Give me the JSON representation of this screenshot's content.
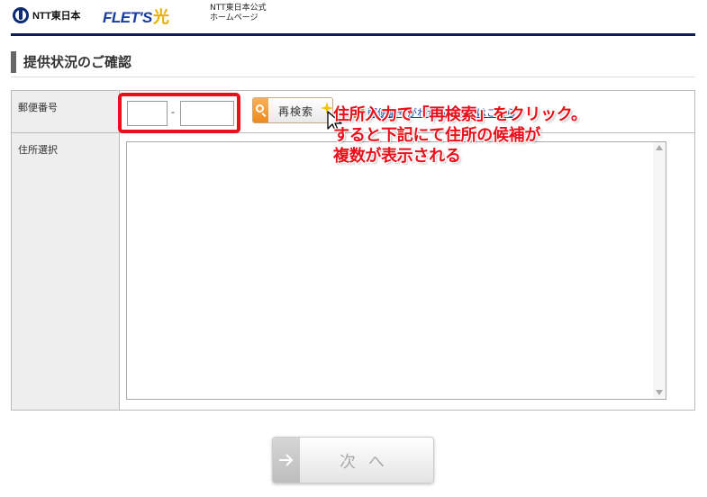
{
  "header": {
    "ntt_logo_text": "NTT東日本",
    "flets_logo_text": "FLET'S",
    "flets_light_text": "光",
    "official_line1": "NTT東日本公式",
    "official_line2": "ホームページ"
  },
  "page": {
    "title": "提供状況のご確認"
  },
  "form": {
    "postal_label": "郵便番号",
    "postal_first_value": "",
    "postal_separator": "-",
    "postal_second_value": "",
    "research_button_label": "再検索",
    "help_link_text": "郵便番号がわからない方はこちら",
    "address_label": "住所選択",
    "address_options": []
  },
  "annotation": {
    "line1": "住所入力で「再検索」をクリック。",
    "line2": "すると下記にて住所の候補が",
    "line3": "複数が表示される"
  },
  "next_button": {
    "label": "次へ"
  },
  "colors": {
    "header_rule": "#0d1b59",
    "highlight": "#e8101a",
    "annotation_text": "#e8101a",
    "link": "#1a4ea8",
    "accent_orange": "#ee8a1c"
  },
  "icons": {
    "ntt": "ntt-logo-icon",
    "search": "search-icon",
    "cursor": "cursor-arrow-icon",
    "help": "arrow-right-icon",
    "next": "arrow-right-icon"
  }
}
